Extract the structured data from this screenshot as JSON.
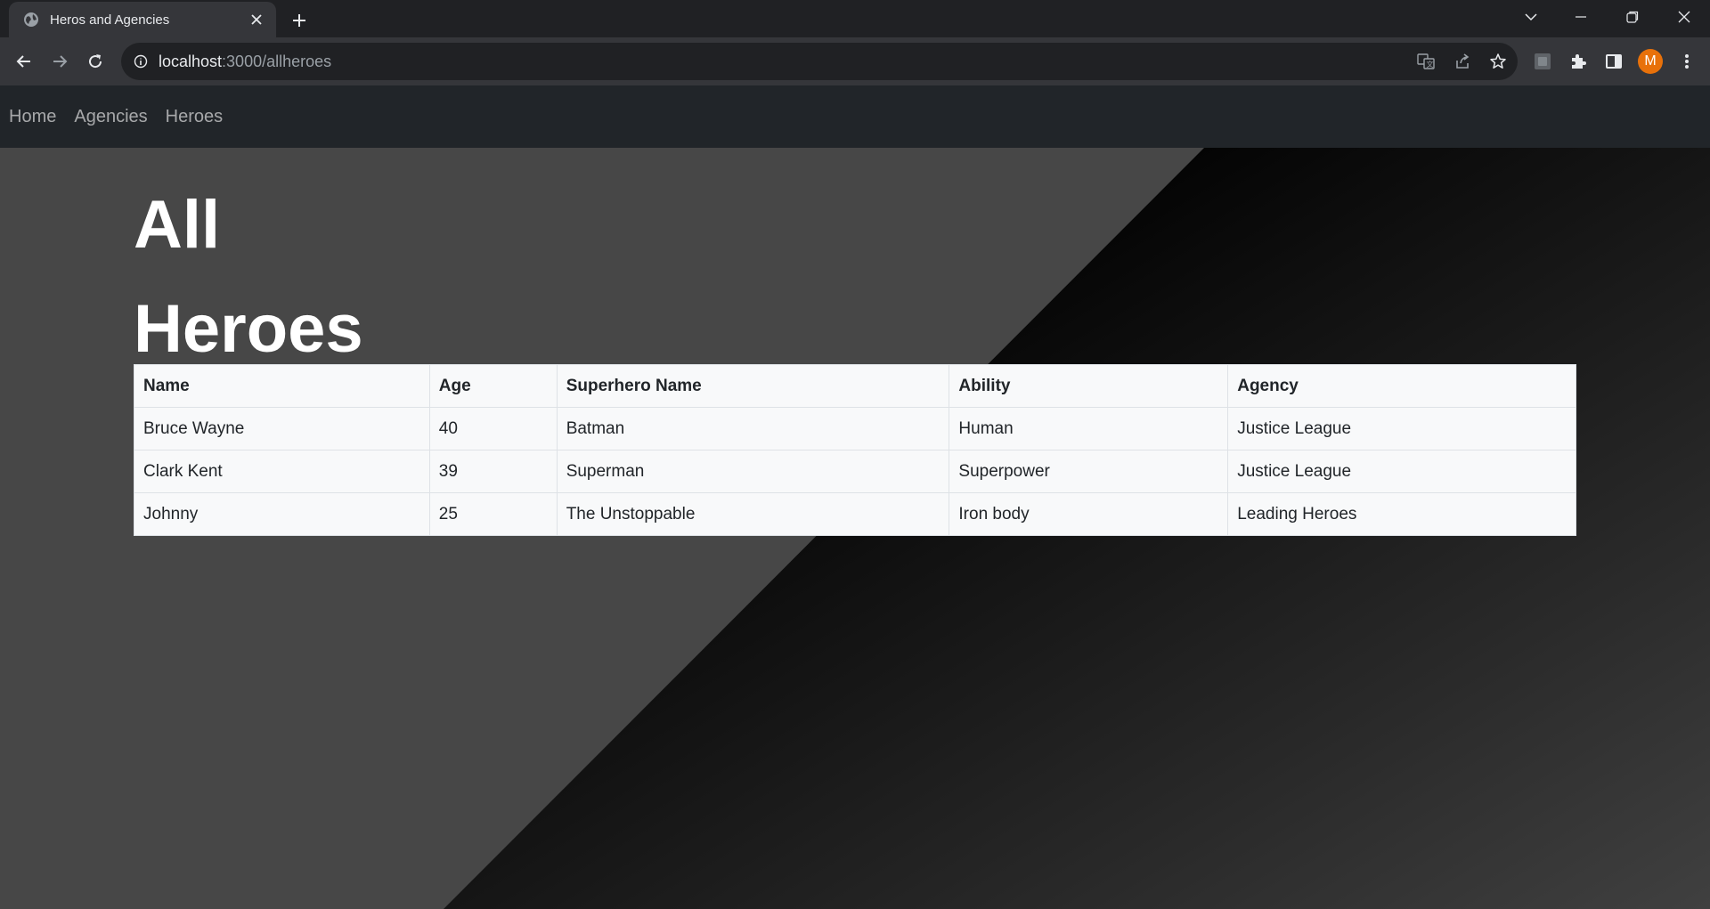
{
  "browser": {
    "tab_title": "Heros and Agencies",
    "url_host": "localhost",
    "url_path": ":3000/allheroes",
    "profile_initial": "M",
    "profile_color": "#e8710a"
  },
  "navbar": {
    "links": [
      "Home",
      "Agencies",
      "Heroes"
    ]
  },
  "main": {
    "heading": "All Heroes",
    "table": {
      "headers": [
        "Name",
        "Age",
        "Superhero Name",
        "Ability",
        "Agency"
      ],
      "rows": [
        [
          "Bruce Wayne",
          "40",
          "Batman",
          "Human",
          "Justice League"
        ],
        [
          "Clark Kent",
          "39",
          "Superman",
          "Superpower",
          "Justice League"
        ],
        [
          "Johnny",
          "25",
          "The Unstoppable",
          "Iron body",
          "Leading Heroes"
        ]
      ]
    }
  },
  "icons": {
    "tab_favicon": "globe-icon",
    "tab_close": "close-icon",
    "new_tab": "plus-icon",
    "tab_search": "chevron-down-icon",
    "minimize": "minimize-icon",
    "restore": "restore-icon",
    "close_window": "close-icon",
    "back": "arrow-left-icon",
    "forward": "arrow-right-icon",
    "reload": "reload-icon",
    "site_info": "info-icon",
    "translate": "translate-icon",
    "share": "share-icon",
    "bookmark": "star-icon",
    "extension": "extension-puzzle-icon",
    "side_panel": "side-panel-icon",
    "menu": "kebab-menu-icon"
  },
  "colors": {
    "navbar_bg": "#212529",
    "page_bg": "#474747",
    "table_bg": "#f8f9fa"
  }
}
